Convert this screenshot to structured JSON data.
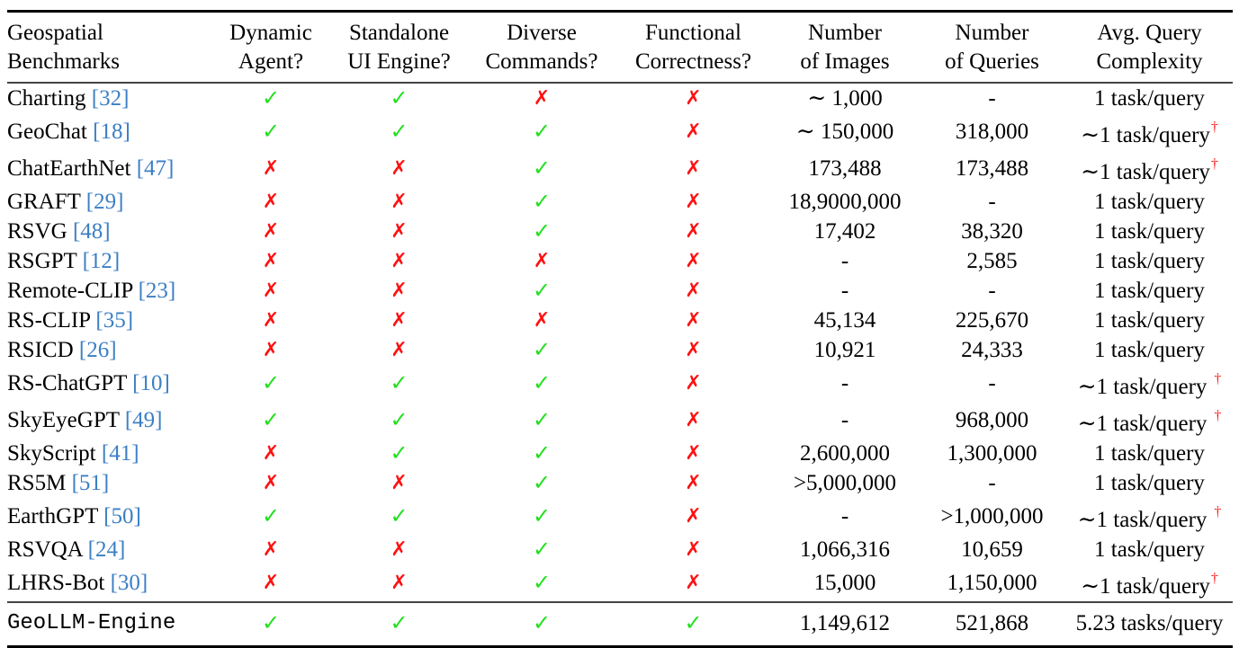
{
  "colors": {
    "check": "#22e01e",
    "cross": "#ff1010",
    "reference": "#3b7fc4",
    "dagger": "#ff1a1a"
  },
  "icons": {
    "yes": "check-mark-icon",
    "no": "cross-mark-icon"
  },
  "glyphs": {
    "yes": "✓",
    "no": "✗",
    "dagger": "†"
  },
  "headers": [
    {
      "line1": "Geospatial",
      "line2": "Benchmarks"
    },
    {
      "line1": "Dynamic",
      "line2": "Agent?"
    },
    {
      "line1": "Standalone",
      "line2": "UI Engine?"
    },
    {
      "line1": "Diverse",
      "line2": "Commands?"
    },
    {
      "line1": "Functional",
      "line2": "Correctness?"
    },
    {
      "line1": "Number",
      "line2": "of Images"
    },
    {
      "line1": "Number",
      "line2": "of Queries"
    },
    {
      "line1": "Avg. Query",
      "line2": "Complexity"
    }
  ],
  "rows": [
    {
      "name": "Charting",
      "ref": "[32]",
      "dynamic": true,
      "standalone": true,
      "diverse": false,
      "functional": false,
      "images": "∼ 1,000",
      "queries": "-",
      "complexity": "1 task/query",
      "dagger": false
    },
    {
      "name": "GeoChat",
      "ref": "[18]",
      "dynamic": true,
      "standalone": true,
      "diverse": true,
      "functional": false,
      "images": "∼ 150,000",
      "queries": "318,000",
      "complexity": "∼1 task/query",
      "dagger": true
    },
    {
      "name": "ChatEarthNet",
      "ref": "[47]",
      "dynamic": false,
      "standalone": false,
      "diverse": true,
      "functional": false,
      "images": "173,488",
      "queries": "173,488",
      "complexity": "∼1 task/query",
      "dagger": true
    },
    {
      "name": "GRAFT",
      "ref": "[29]",
      "dynamic": false,
      "standalone": false,
      "diverse": true,
      "functional": false,
      "images": "18,9000,000",
      "queries": "-",
      "complexity": "1 task/query",
      "dagger": false
    },
    {
      "name": "RSVG",
      "ref": "[48]",
      "dynamic": false,
      "standalone": false,
      "diverse": true,
      "functional": false,
      "images": "17,402",
      "queries": "38,320",
      "complexity": "1 task/query",
      "dagger": false
    },
    {
      "name": "RSGPT",
      "ref": "[12]",
      "dynamic": false,
      "standalone": false,
      "diverse": false,
      "functional": false,
      "images": "-",
      "queries": "2,585",
      "complexity": "1 task/query",
      "dagger": false
    },
    {
      "name": "Remote-CLIP",
      "ref": "[23]",
      "dynamic": false,
      "standalone": false,
      "diverse": true,
      "functional": false,
      "images": "-",
      "queries": "-",
      "complexity": "1 task/query",
      "dagger": false
    },
    {
      "name": "RS-CLIP",
      "ref": "[35]",
      "dynamic": false,
      "standalone": false,
      "diverse": false,
      "functional": false,
      "images": "45,134",
      "queries": "225,670",
      "complexity": "1 task/query",
      "dagger": false
    },
    {
      "name": "RSICD",
      "ref": "[26]",
      "dynamic": false,
      "standalone": false,
      "diverse": true,
      "functional": false,
      "images": "10,921",
      "queries": "24,333",
      "complexity": "1 task/query",
      "dagger": false
    },
    {
      "name": "RS-ChatGPT",
      "ref": "[10]",
      "dynamic": true,
      "standalone": true,
      "diverse": true,
      "functional": false,
      "images": "-",
      "queries": "-",
      "complexity": "∼1 task/query",
      "dagger": true,
      "dagger_spaced": true
    },
    {
      "name": "SkyEyeGPT",
      "ref": "[49]",
      "dynamic": true,
      "standalone": true,
      "diverse": true,
      "functional": false,
      "images": "-",
      "queries": "968,000",
      "complexity": "∼1 task/query",
      "dagger": true,
      "dagger_spaced": true
    },
    {
      "name": "SkyScript",
      "ref": "[41]",
      "dynamic": false,
      "standalone": true,
      "diverse": true,
      "functional": false,
      "images": "2,600,000",
      "queries": "1,300,000",
      "complexity": "1 task/query",
      "dagger": false
    },
    {
      "name": "RS5M",
      "ref": "[51]",
      "dynamic": false,
      "standalone": false,
      "diverse": true,
      "functional": false,
      "images": ">5,000,000",
      "queries": "-",
      "complexity": "1 task/query",
      "dagger": false
    },
    {
      "name": "EarthGPT",
      "ref": "[50]",
      "dynamic": true,
      "standalone": true,
      "diverse": true,
      "functional": false,
      "images": "-",
      "queries": ">1,000,000",
      "complexity": "∼1 task/query",
      "dagger": true,
      "dagger_spaced": true
    },
    {
      "name": "RSVQA",
      "ref": "[24]",
      "dynamic": false,
      "standalone": false,
      "diverse": true,
      "functional": false,
      "images": "1,066,316",
      "queries": "10,659",
      "complexity": "1 task/query",
      "dagger": false
    },
    {
      "name": "LHRS-Bot",
      "ref": "[30]",
      "dynamic": false,
      "standalone": false,
      "diverse": true,
      "functional": false,
      "images": "15,000",
      "queries": "1,150,000",
      "complexity": "∼1 task/query",
      "dagger": true
    }
  ],
  "ours": {
    "name": "GeoLLM-Engine",
    "dynamic": true,
    "standalone": true,
    "diverse": true,
    "functional": true,
    "images": "1,149,612",
    "queries": "521,868",
    "complexity": "5.23 tasks/query"
  }
}
